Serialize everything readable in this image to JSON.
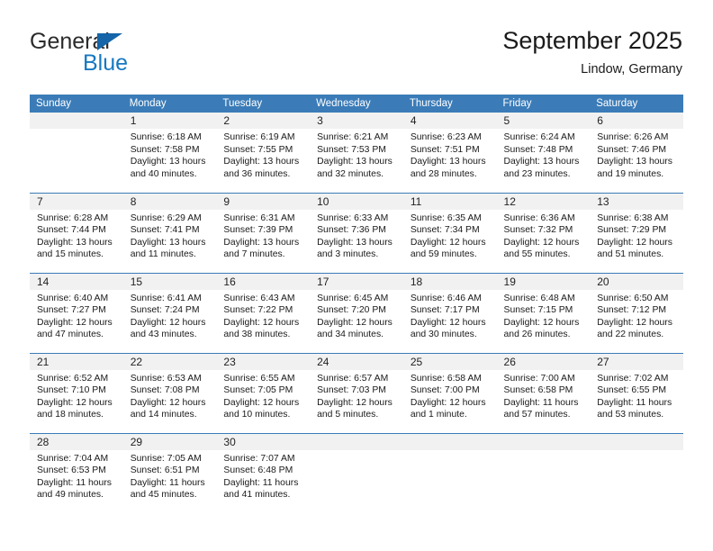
{
  "brand": {
    "name_part1": "General",
    "name_part2": "Blue",
    "triangle_color": "#1565a8",
    "blue_color": "#1678c2"
  },
  "header": {
    "title": "September 2025",
    "location": "Lindow, Germany",
    "accent_color": "#3b7cb8"
  },
  "weekday_headers": [
    "Sunday",
    "Monday",
    "Tuesday",
    "Wednesday",
    "Thursday",
    "Friday",
    "Saturday"
  ],
  "labels": {
    "sunrise_prefix": "Sunrise:",
    "sunset_prefix": "Sunset:",
    "daylight_prefix": "Daylight:"
  },
  "weeks": [
    [
      {
        "day": "",
        "sunrise": "",
        "sunset": "",
        "daylight_line1": "",
        "daylight_line2": ""
      },
      {
        "day": "1",
        "sunrise": "Sunrise: 6:18 AM",
        "sunset": "Sunset: 7:58 PM",
        "daylight_line1": "Daylight: 13 hours",
        "daylight_line2": "and 40 minutes."
      },
      {
        "day": "2",
        "sunrise": "Sunrise: 6:19 AM",
        "sunset": "Sunset: 7:55 PM",
        "daylight_line1": "Daylight: 13 hours",
        "daylight_line2": "and 36 minutes."
      },
      {
        "day": "3",
        "sunrise": "Sunrise: 6:21 AM",
        "sunset": "Sunset: 7:53 PM",
        "daylight_line1": "Daylight: 13 hours",
        "daylight_line2": "and 32 minutes."
      },
      {
        "day": "4",
        "sunrise": "Sunrise: 6:23 AM",
        "sunset": "Sunset: 7:51 PM",
        "daylight_line1": "Daylight: 13 hours",
        "daylight_line2": "and 28 minutes."
      },
      {
        "day": "5",
        "sunrise": "Sunrise: 6:24 AM",
        "sunset": "Sunset: 7:48 PM",
        "daylight_line1": "Daylight: 13 hours",
        "daylight_line2": "and 23 minutes."
      },
      {
        "day": "6",
        "sunrise": "Sunrise: 6:26 AM",
        "sunset": "Sunset: 7:46 PM",
        "daylight_line1": "Daylight: 13 hours",
        "daylight_line2": "and 19 minutes."
      }
    ],
    [
      {
        "day": "7",
        "sunrise": "Sunrise: 6:28 AM",
        "sunset": "Sunset: 7:44 PM",
        "daylight_line1": "Daylight: 13 hours",
        "daylight_line2": "and 15 minutes."
      },
      {
        "day": "8",
        "sunrise": "Sunrise: 6:29 AM",
        "sunset": "Sunset: 7:41 PM",
        "daylight_line1": "Daylight: 13 hours",
        "daylight_line2": "and 11 minutes."
      },
      {
        "day": "9",
        "sunrise": "Sunrise: 6:31 AM",
        "sunset": "Sunset: 7:39 PM",
        "daylight_line1": "Daylight: 13 hours",
        "daylight_line2": "and 7 minutes."
      },
      {
        "day": "10",
        "sunrise": "Sunrise: 6:33 AM",
        "sunset": "Sunset: 7:36 PM",
        "daylight_line1": "Daylight: 13 hours",
        "daylight_line2": "and 3 minutes."
      },
      {
        "day": "11",
        "sunrise": "Sunrise: 6:35 AM",
        "sunset": "Sunset: 7:34 PM",
        "daylight_line1": "Daylight: 12 hours",
        "daylight_line2": "and 59 minutes."
      },
      {
        "day": "12",
        "sunrise": "Sunrise: 6:36 AM",
        "sunset": "Sunset: 7:32 PM",
        "daylight_line1": "Daylight: 12 hours",
        "daylight_line2": "and 55 minutes."
      },
      {
        "day": "13",
        "sunrise": "Sunrise: 6:38 AM",
        "sunset": "Sunset: 7:29 PM",
        "daylight_line1": "Daylight: 12 hours",
        "daylight_line2": "and 51 minutes."
      }
    ],
    [
      {
        "day": "14",
        "sunrise": "Sunrise: 6:40 AM",
        "sunset": "Sunset: 7:27 PM",
        "daylight_line1": "Daylight: 12 hours",
        "daylight_line2": "and 47 minutes."
      },
      {
        "day": "15",
        "sunrise": "Sunrise: 6:41 AM",
        "sunset": "Sunset: 7:24 PM",
        "daylight_line1": "Daylight: 12 hours",
        "daylight_line2": "and 43 minutes."
      },
      {
        "day": "16",
        "sunrise": "Sunrise: 6:43 AM",
        "sunset": "Sunset: 7:22 PM",
        "daylight_line1": "Daylight: 12 hours",
        "daylight_line2": "and 38 minutes."
      },
      {
        "day": "17",
        "sunrise": "Sunrise: 6:45 AM",
        "sunset": "Sunset: 7:20 PM",
        "daylight_line1": "Daylight: 12 hours",
        "daylight_line2": "and 34 minutes."
      },
      {
        "day": "18",
        "sunrise": "Sunrise: 6:46 AM",
        "sunset": "Sunset: 7:17 PM",
        "daylight_line1": "Daylight: 12 hours",
        "daylight_line2": "and 30 minutes."
      },
      {
        "day": "19",
        "sunrise": "Sunrise: 6:48 AM",
        "sunset": "Sunset: 7:15 PM",
        "daylight_line1": "Daylight: 12 hours",
        "daylight_line2": "and 26 minutes."
      },
      {
        "day": "20",
        "sunrise": "Sunrise: 6:50 AM",
        "sunset": "Sunset: 7:12 PM",
        "daylight_line1": "Daylight: 12 hours",
        "daylight_line2": "and 22 minutes."
      }
    ],
    [
      {
        "day": "21",
        "sunrise": "Sunrise: 6:52 AM",
        "sunset": "Sunset: 7:10 PM",
        "daylight_line1": "Daylight: 12 hours",
        "daylight_line2": "and 18 minutes."
      },
      {
        "day": "22",
        "sunrise": "Sunrise: 6:53 AM",
        "sunset": "Sunset: 7:08 PM",
        "daylight_line1": "Daylight: 12 hours",
        "daylight_line2": "and 14 minutes."
      },
      {
        "day": "23",
        "sunrise": "Sunrise: 6:55 AM",
        "sunset": "Sunset: 7:05 PM",
        "daylight_line1": "Daylight: 12 hours",
        "daylight_line2": "and 10 minutes."
      },
      {
        "day": "24",
        "sunrise": "Sunrise: 6:57 AM",
        "sunset": "Sunset: 7:03 PM",
        "daylight_line1": "Daylight: 12 hours",
        "daylight_line2": "and 5 minutes."
      },
      {
        "day": "25",
        "sunrise": "Sunrise: 6:58 AM",
        "sunset": "Sunset: 7:00 PM",
        "daylight_line1": "Daylight: 12 hours",
        "daylight_line2": "and 1 minute."
      },
      {
        "day": "26",
        "sunrise": "Sunrise: 7:00 AM",
        "sunset": "Sunset: 6:58 PM",
        "daylight_line1": "Daylight: 11 hours",
        "daylight_line2": "and 57 minutes."
      },
      {
        "day": "27",
        "sunrise": "Sunrise: 7:02 AM",
        "sunset": "Sunset: 6:55 PM",
        "daylight_line1": "Daylight: 11 hours",
        "daylight_line2": "and 53 minutes."
      }
    ],
    [
      {
        "day": "28",
        "sunrise": "Sunrise: 7:04 AM",
        "sunset": "Sunset: 6:53 PM",
        "daylight_line1": "Daylight: 11 hours",
        "daylight_line2": "and 49 minutes."
      },
      {
        "day": "29",
        "sunrise": "Sunrise: 7:05 AM",
        "sunset": "Sunset: 6:51 PM",
        "daylight_line1": "Daylight: 11 hours",
        "daylight_line2": "and 45 minutes."
      },
      {
        "day": "30",
        "sunrise": "Sunrise: 7:07 AM",
        "sunset": "Sunset: 6:48 PM",
        "daylight_line1": "Daylight: 11 hours",
        "daylight_line2": "and 41 minutes."
      },
      {
        "day": "",
        "sunrise": "",
        "sunset": "",
        "daylight_line1": "",
        "daylight_line2": ""
      },
      {
        "day": "",
        "sunrise": "",
        "sunset": "",
        "daylight_line1": "",
        "daylight_line2": ""
      },
      {
        "day": "",
        "sunrise": "",
        "sunset": "",
        "daylight_line1": "",
        "daylight_line2": ""
      },
      {
        "day": "",
        "sunrise": "",
        "sunset": "",
        "daylight_line1": "",
        "daylight_line2": ""
      }
    ]
  ]
}
